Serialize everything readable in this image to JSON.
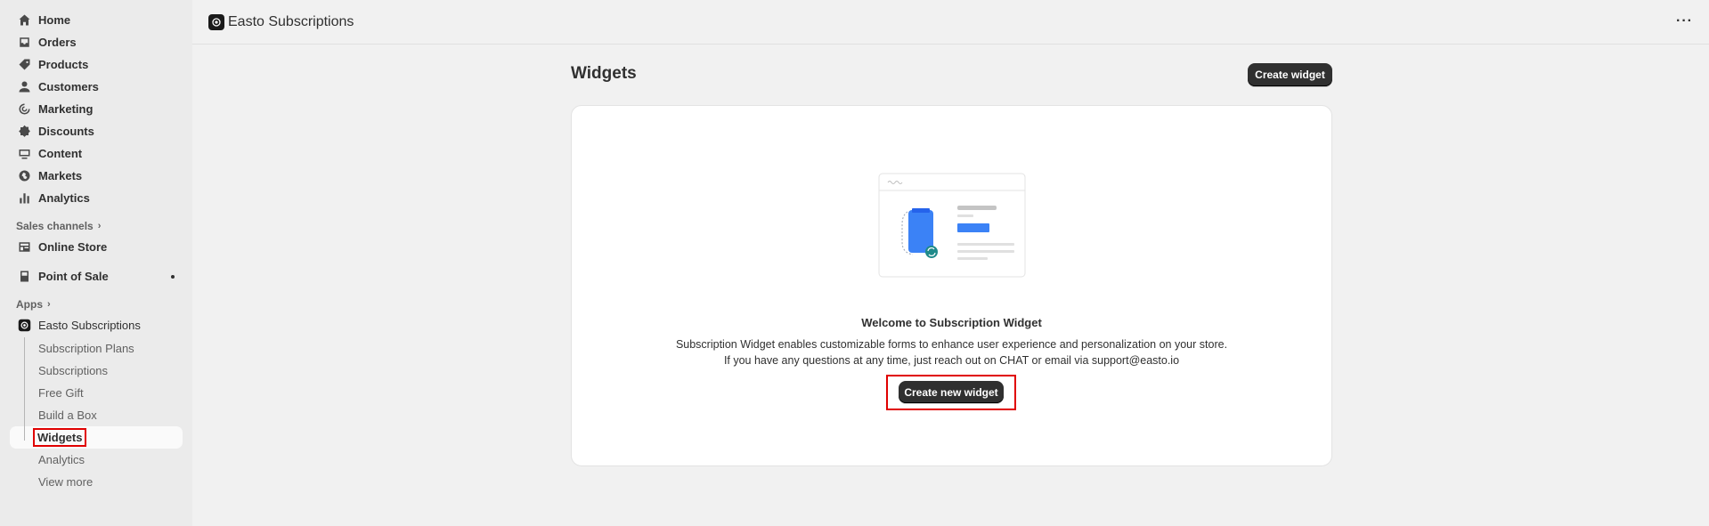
{
  "sidebar": {
    "items": [
      {
        "label": "Home",
        "icon": "home-icon"
      },
      {
        "label": "Orders",
        "icon": "inbox-icon"
      },
      {
        "label": "Products",
        "icon": "tag-icon"
      },
      {
        "label": "Customers",
        "icon": "person-icon"
      },
      {
        "label": "Marketing",
        "icon": "target-icon"
      },
      {
        "label": "Discounts",
        "icon": "discount-icon"
      },
      {
        "label": "Content",
        "icon": "image-icon"
      },
      {
        "label": "Markets",
        "icon": "globe-icon"
      },
      {
        "label": "Analytics",
        "icon": "bar-chart-icon"
      }
    ],
    "sales_channels_label": "Sales channels",
    "online_store_label": "Online Store",
    "point_of_sale_label": "Point of Sale",
    "apps_label": "Apps",
    "app_name": "Easto Subscriptions",
    "sub_items": [
      {
        "label": "Subscription Plans"
      },
      {
        "label": "Subscriptions"
      },
      {
        "label": "Free Gift"
      },
      {
        "label": "Build a Box"
      },
      {
        "label": "Widgets",
        "active": true
      },
      {
        "label": "Analytics"
      },
      {
        "label": "View more"
      }
    ]
  },
  "topbar": {
    "app_title": "Easto Subscriptions",
    "more_label": "···"
  },
  "main": {
    "page_title": "Widgets",
    "create_widget_label": "Create widget",
    "empty_state": {
      "title": "Welcome to Subscription Widget",
      "description_line1": "Subscription Widget enables customizable forms to enhance user experience and personalization on your store.",
      "description_line2": "If you have any questions at any time, just reach out on CHAT or email via support@easto.io",
      "cta_label": "Create new widget"
    }
  },
  "colors": {
    "highlight": "#e00000",
    "button_dark": "#303030",
    "illustration_blue": "#3b82f6",
    "illustration_teal": "#1f8a8a"
  }
}
